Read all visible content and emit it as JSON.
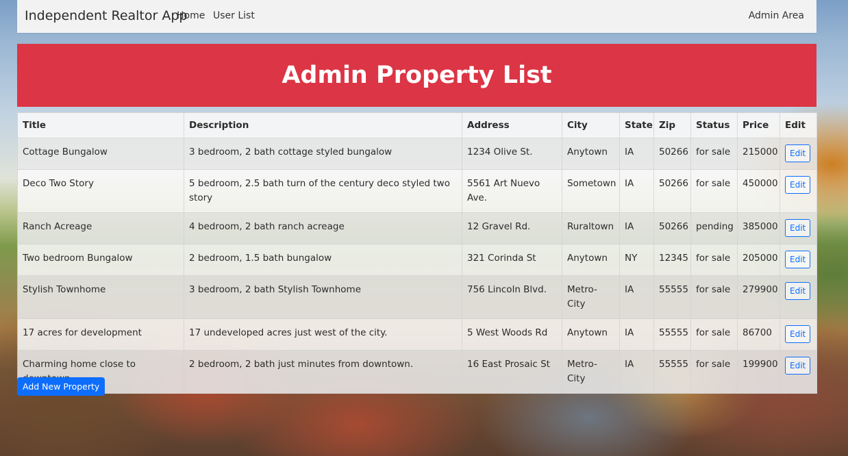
{
  "navbar": {
    "brand": "Independent Realtor App",
    "links": [
      "Home",
      "User List"
    ],
    "admin_link": "Admin Area"
  },
  "header": {
    "title": "Admin Property List"
  },
  "table": {
    "columns": [
      "Title",
      "Description",
      "Address",
      "City",
      "State",
      "Zip",
      "Status",
      "Price",
      "Edit"
    ],
    "rows": [
      {
        "title": "Cottage Bungalow",
        "description": "3 bedroom, 2 bath cottage styled bungalow",
        "address": "1234 Olive St.",
        "city": "Anytown",
        "state": "IA",
        "zip": "50266",
        "status": "for sale",
        "price": "215000",
        "edit": "Edit"
      },
      {
        "title": "Deco Two Story",
        "description": "5 bedroom, 2.5 bath turn of the century deco styled two story",
        "address": "5561 Art Nuevo Ave.",
        "city": "Sometown",
        "state": "IA",
        "zip": "50266",
        "status": "for sale",
        "price": "450000",
        "edit": "Edit"
      },
      {
        "title": "Ranch Acreage",
        "description": "4 bedroom, 2 bath ranch acreage",
        "address": "12 Gravel Rd.",
        "city": "Ruraltown",
        "state": "IA",
        "zip": "50266",
        "status": "pending",
        "price": "385000",
        "edit": "Edit"
      },
      {
        "title": "Two bedroom Bungalow",
        "description": "2 bedroom, 1.5 bath bungalow",
        "address": "321 Corinda St",
        "city": "Anytown",
        "state": "NY",
        "zip": "12345",
        "status": "for sale",
        "price": "205000",
        "edit": "Edit"
      },
      {
        "title": "Stylish Townhome",
        "description": "3 bedroom, 2 bath Stylish Townhome",
        "address": "756 Lincoln Blvd.",
        "city": "Metro-City",
        "state": "IA",
        "zip": "55555",
        "status": "for sale",
        "price": "279900",
        "edit": "Edit"
      },
      {
        "title": "17 acres for development",
        "description": "17 undeveloped acres just west of the city.",
        "address": "5 West Woods Rd",
        "city": "Anytown",
        "state": "IA",
        "zip": "55555",
        "status": "for sale",
        "price": "86700",
        "edit": "Edit"
      },
      {
        "title": "Charming home close to downtown",
        "description": "2 bedroom, 2 bath just minutes from downtown.",
        "address": "16 East Prosaic St",
        "city": "Metro-City",
        "state": "IA",
        "zip": "55555",
        "status": "for sale",
        "price": "199900",
        "edit": "Edit"
      }
    ]
  },
  "actions": {
    "add_label": "Add New Property"
  },
  "colors": {
    "header_bg": "#dc3545",
    "primary": "#0d6efd",
    "navbar_bg": "#f2f2f2"
  }
}
